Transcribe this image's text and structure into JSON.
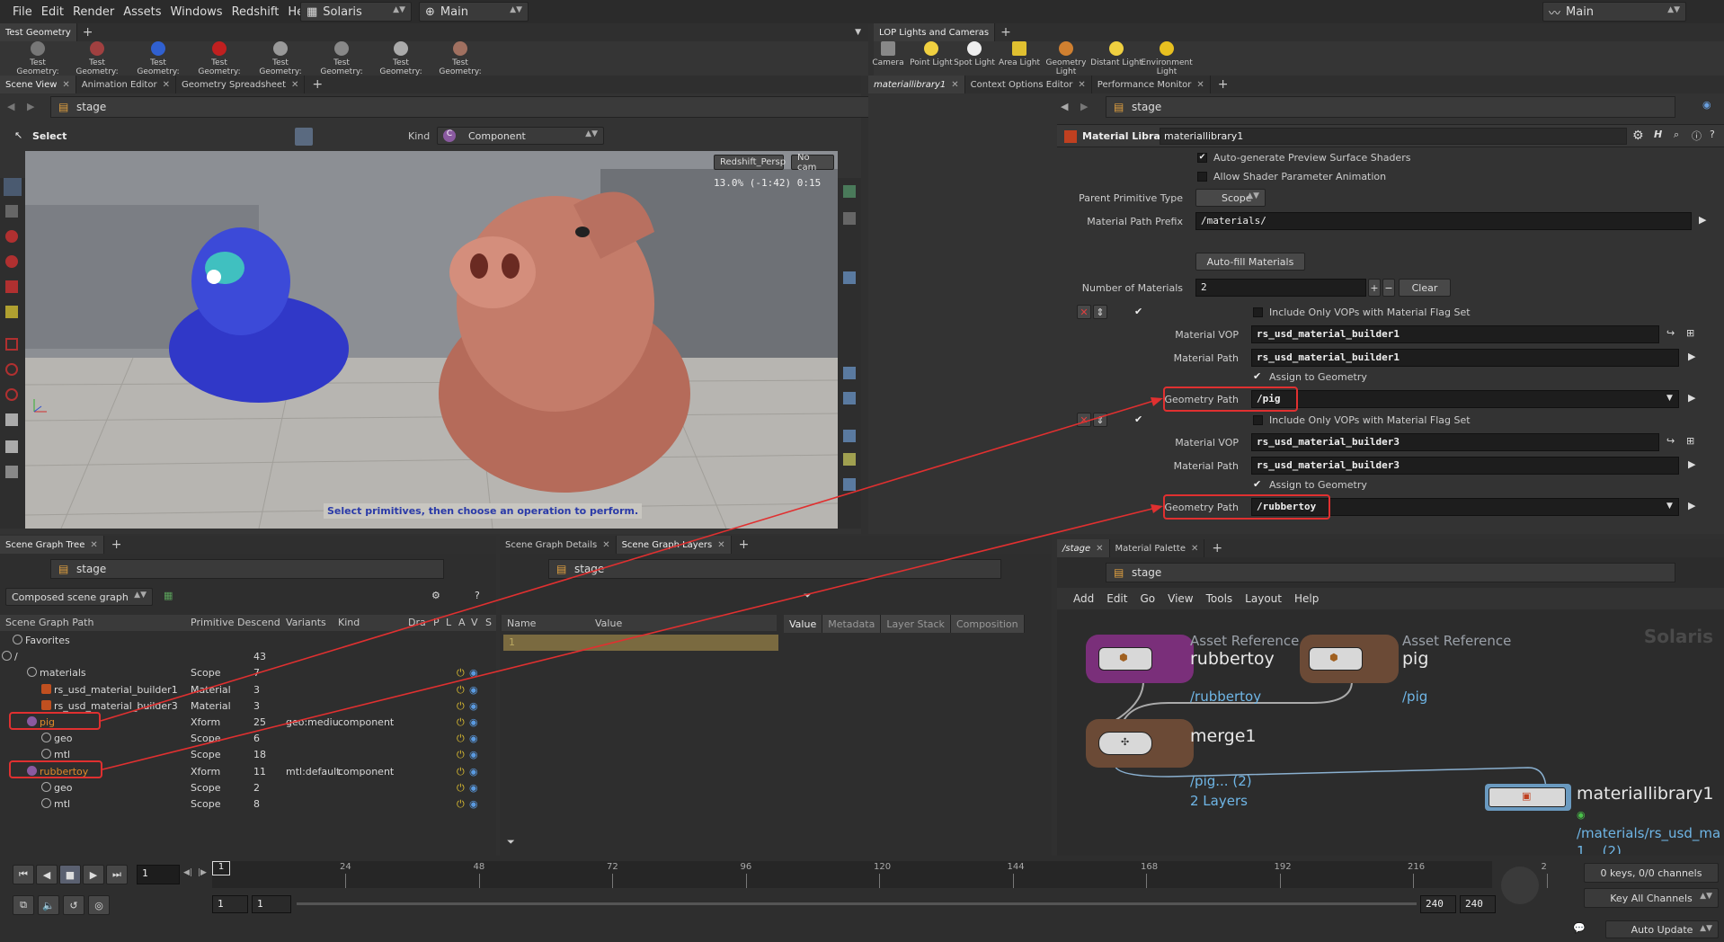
{
  "menubar": {
    "items": [
      "File",
      "Edit",
      "Render",
      "Assets",
      "Windows",
      "Redshift",
      "Help"
    ],
    "desktop": "Solaris",
    "context": "Main",
    "main_right": "Main"
  },
  "shelf_left": {
    "tab": "Test Geometry",
    "tools": [
      "Test Geometry: C...",
      "Test Geometry: P...",
      "Test Geometry: R...",
      "Test Geometry: S...",
      "Test Geometry: S...",
      "Test Geometry: T...",
      "Test Geometry: T...",
      "Test Geometry: T..."
    ]
  },
  "shelf_right": {
    "tab": "LOP Lights and Cameras",
    "tools": [
      "Camera",
      "Point Light",
      "Spot Light",
      "Area Light",
      "Geometry Light",
      "Distant Light",
      "Environment Light"
    ]
  },
  "scene_view": {
    "tabs": [
      "Scene View",
      "Animation Editor",
      "Geometry Spreadsheet"
    ],
    "path": "stage",
    "select_label": "Select",
    "kind_label": "Kind",
    "kind_value": "Component",
    "camera": "Redshift_Persp",
    "nocam": "No cam",
    "readout": "13.0%  (-1:42)  0:15",
    "hint": "Select primitives, then choose an operation to perform."
  },
  "param_panel": {
    "tabs": [
      "materiallibrary1",
      "Context Options Editor",
      "Performance Monitor"
    ],
    "path": "stage",
    "node_type": "Material Library",
    "node_name": "materiallibrary1",
    "auto_gen": "Auto-generate Preview Surface Shaders",
    "allow_anim": "Allow Shader Parameter Animation",
    "parent_prim_label": "Parent Primitive Type",
    "parent_prim_value": "Scope",
    "mat_prefix_label": "Material Path Prefix",
    "mat_prefix_value": "/materials/",
    "autofill": "Auto-fill Materials",
    "num_label": "Number of Materials",
    "num_value": "2",
    "clear": "Clear",
    "materials": [
      {
        "include_vops": "Include Only VOPs with Material Flag Set",
        "vop_label": "Material VOP",
        "vop": "rs_usd_material_builder1",
        "path_label": "Material Path",
        "path": "rs_usd_material_builder1",
        "assign": "Assign to Geometry",
        "geo_label": "Geometry Path",
        "geo": "/pig"
      },
      {
        "include_vops": "Include Only VOPs with Material Flag Set",
        "vop_label": "Material VOP",
        "vop": "rs_usd_material_builder3",
        "path_label": "Material Path",
        "path": "rs_usd_material_builder3",
        "assign": "Assign to Geometry",
        "geo_label": "Geometry Path",
        "geo": "/rubbertoy"
      }
    ]
  },
  "scene_tree": {
    "tab": "Scene Graph Tree",
    "path": "stage",
    "mode": "Composed scene graph",
    "columns": [
      "Scene Graph Path",
      "Primitive",
      "Descend",
      "Variants",
      "Kind",
      "Dra",
      "P",
      "L",
      "A",
      "V",
      "S"
    ],
    "rows": [
      {
        "name": "Favorites",
        "prim": "",
        "desc": "",
        "var": "",
        "kind": ""
      },
      {
        "name": "/",
        "prim": "",
        "desc": "43",
        "var": "",
        "kind": ""
      },
      {
        "name": "materials",
        "prim": "Scope",
        "desc": "7",
        "var": "",
        "kind": ""
      },
      {
        "name": "rs_usd_material_builder1",
        "prim": "Material",
        "desc": "3",
        "var": "",
        "kind": ""
      },
      {
        "name": "rs_usd_material_builder3",
        "prim": "Material",
        "desc": "3",
        "var": "",
        "kind": ""
      },
      {
        "name": "pig",
        "prim": "Xform",
        "desc": "25",
        "var": "geo:mediu",
        "kind": "component"
      },
      {
        "name": "geo",
        "prim": "Scope",
        "desc": "6",
        "var": "",
        "kind": ""
      },
      {
        "name": "mtl",
        "prim": "Scope",
        "desc": "18",
        "var": "",
        "kind": ""
      },
      {
        "name": "rubbertoy",
        "prim": "Xform",
        "desc": "11",
        "var": "mtl:default",
        "kind": "component"
      },
      {
        "name": "geo",
        "prim": "Scope",
        "desc": "2",
        "var": "",
        "kind": ""
      },
      {
        "name": "mtl",
        "prim": "Scope",
        "desc": "8",
        "var": "",
        "kind": ""
      }
    ]
  },
  "details": {
    "tabs": [
      "Scene Graph Details",
      "Scene Graph Layers"
    ],
    "path": "stage",
    "name_col": "Name",
    "value_col": "Value",
    "right_tabs": [
      "Value",
      "Metadata",
      "Layer Stack",
      "Composition"
    ],
    "row_idx": "1"
  },
  "network": {
    "tabs": [
      "/stage",
      "Material Palette"
    ],
    "path": "stage",
    "menu": [
      "Add",
      "Edit",
      "Go",
      "View",
      "Tools",
      "Layout",
      "Help"
    ],
    "watermark": "Solaris",
    "nodes": {
      "rubbertoy_type": "Asset Reference",
      "rubbertoy": "rubbertoy",
      "rubbertoy_path": "/rubbertoy",
      "pig_type": "Asset Reference",
      "pig": "pig",
      "pig_path": "/pig",
      "merge": "merge1",
      "merge_info1": "/pig... (2)",
      "merge_info2": "2 Layers",
      "matlib": "materiallibrary1",
      "matlib_info": "/materials/rs_usd_ma",
      "matlib_info2": "1... (2)"
    }
  },
  "timeline": {
    "frame": "1",
    "ticks": [
      "24",
      "48",
      "72",
      "96",
      "120",
      "144",
      "168",
      "192",
      "216",
      "2"
    ],
    "start": "1",
    "start2": "1",
    "end": "240",
    "end2": "240",
    "keys": "0 keys, 0/0 channels",
    "keyall": "Key All Channels",
    "autoupdate": "Auto Update",
    "current_marker": "1"
  },
  "colors": {
    "accent_red": "#e03030",
    "pig_node": "#6b4a36",
    "rubbertoy_node": "#7a2f7a",
    "merge_node": "#6b4a36"
  }
}
